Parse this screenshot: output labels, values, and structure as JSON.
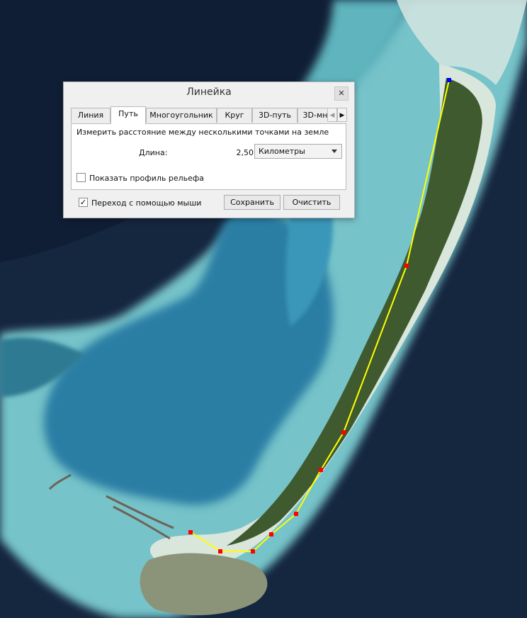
{
  "dialog": {
    "title": "Линейка",
    "close_glyph": "✕",
    "tabs": [
      {
        "label": "Линия",
        "active": false
      },
      {
        "label": "Путь",
        "active": true
      },
      {
        "label": "Многоугольник",
        "active": false
      },
      {
        "label": "Круг",
        "active": false
      },
      {
        "label": "3D-путь",
        "active": false
      },
      {
        "label": "3D-мн",
        "active": false
      }
    ],
    "tab_scroll_left_glyph": "◀",
    "tab_scroll_right_glyph": "▶",
    "description": "Измерить расстояние между несколькими точками на земле",
    "length_label": "Длина:",
    "length_value": "2,50",
    "unit": "Километры",
    "terrain_profile_label": "Показать профиль рельефа",
    "terrain_profile_checked": false,
    "mouse_nav_label": "Переход с помощью мыши",
    "mouse_nav_checked": true,
    "checkmark_glyph": "✓",
    "save_label": "Сохранить",
    "clear_label": "Очистить"
  },
  "map": {
    "colors": {
      "deep_ocean": "#15263f",
      "lagoon_deep": "#2a7ea4",
      "reef_shallow": "#76c3c9",
      "sand": "#d9e6dc",
      "vegetation": "#3f5a2e",
      "path_line": "#ffff00",
      "path_point": "#ff0000",
      "path_start_point": "#0000ff"
    }
  }
}
